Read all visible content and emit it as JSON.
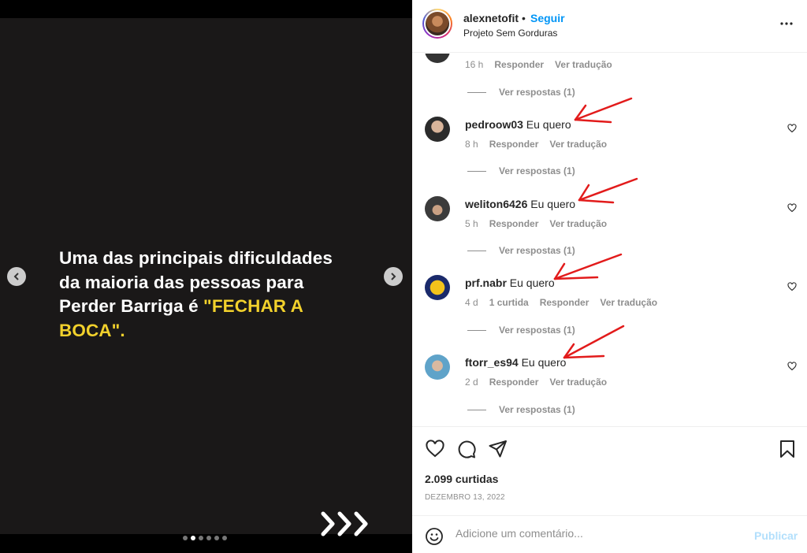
{
  "slide": {
    "text_line1": "Uma das principais dificuldades",
    "text_line2": "da maioria das pessoas para",
    "text_line3_plain": "Perder Barriga é ",
    "text_highlight_a": "\"FECHAR A",
    "text_highlight_b": "BOCA\".",
    "highlight_color": "#f2d12c",
    "dots_total": 6,
    "dots_active": 2
  },
  "header": {
    "username": "alexnetofit",
    "separator": "•",
    "follow_label": "Seguir",
    "subtitle": "Projeto Sem Gorduras"
  },
  "comments": {
    "first_partial": {
      "time": "16 h",
      "reply": "Responder",
      "translate": "Ver tradução",
      "replies": "Ver respostas (1)"
    },
    "items": [
      {
        "user": "pedroow03",
        "text": "Eu quero",
        "time": "8 h",
        "likes": "",
        "reply": "Responder",
        "translate": "Ver tradução",
        "replies": "Ver respostas (1)"
      },
      {
        "user": "weliton6426",
        "text": "Eu quero",
        "time": "5 h",
        "likes": "",
        "reply": "Responder",
        "translate": "Ver tradução",
        "replies": "Ver respostas (1)"
      },
      {
        "user": "prf.nabr",
        "text": "Eu quero",
        "time": "4 d",
        "likes": "1 curtida",
        "reply": "Responder",
        "translate": "Ver tradução",
        "replies": "Ver respostas (1)"
      },
      {
        "user": "ftorr_es94",
        "text": "Eu quero",
        "time": "2 d",
        "likes": "",
        "reply": "Responder",
        "translate": "Ver tradução",
        "replies": "Ver respostas (1)"
      }
    ]
  },
  "footer": {
    "likes": "2.099 curtidas",
    "date": "DEZEMBRO 13, 2022",
    "comment_placeholder": "Adicione um comentário...",
    "publish_label": "Publicar"
  },
  "colors": {
    "accent": "#0095f6",
    "annotation_arrow": "#e21b1b"
  }
}
